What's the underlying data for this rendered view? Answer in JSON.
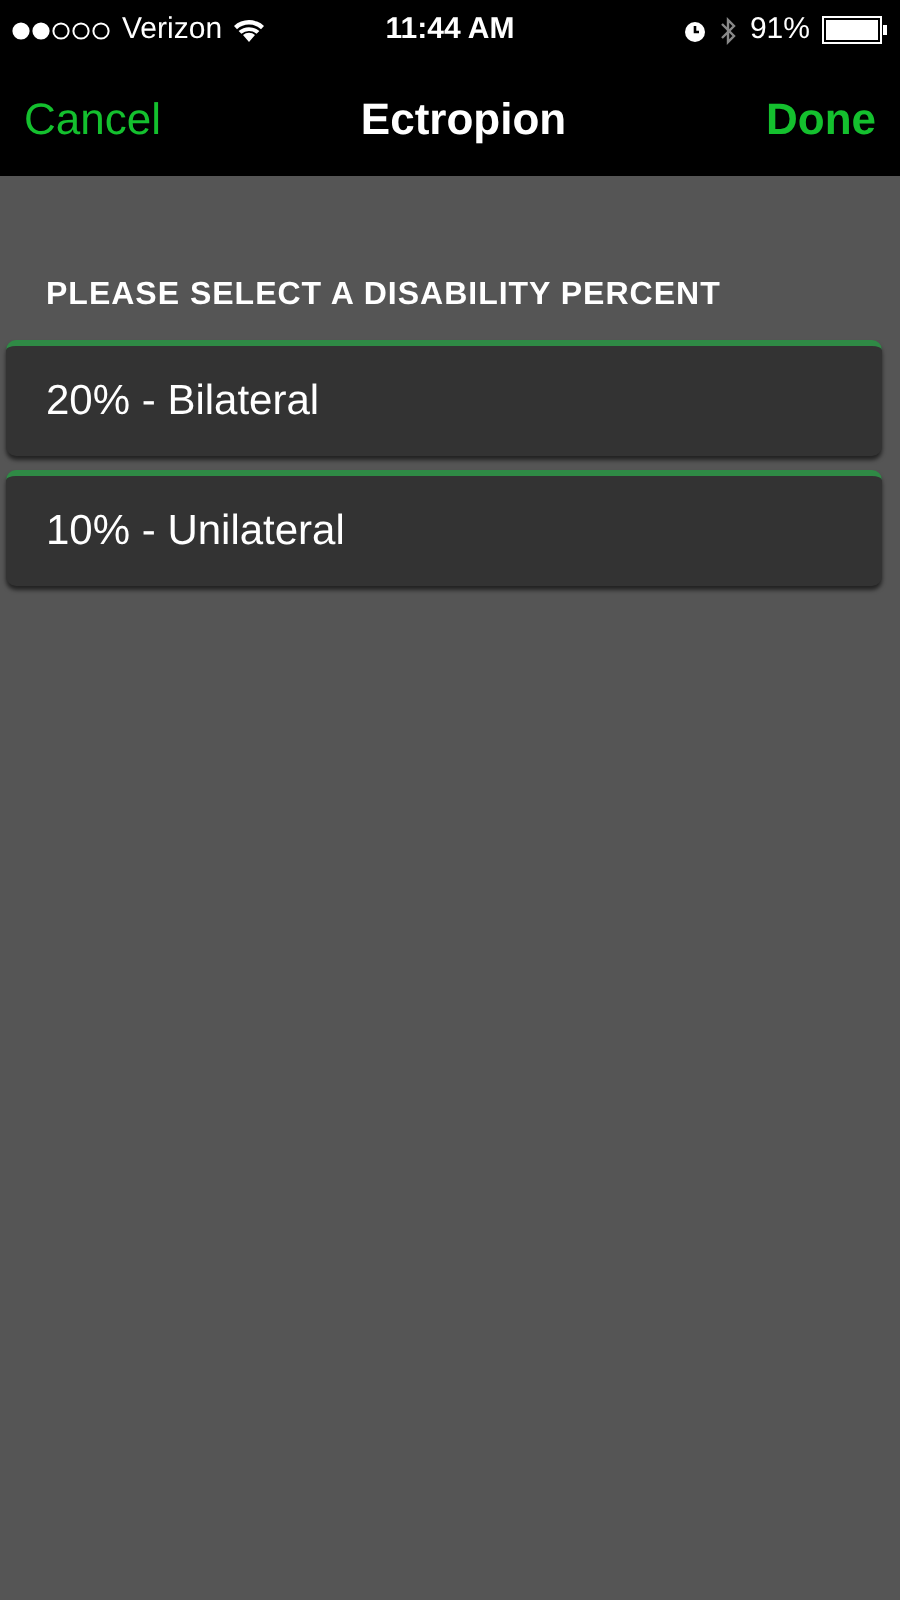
{
  "status_bar": {
    "carrier": "Verizon",
    "time": "11:44 AM",
    "battery": "91%"
  },
  "nav": {
    "cancel": "Cancel",
    "title": "Ectropion",
    "done": "Done"
  },
  "section_header": "PLEASE SELECT A DISABILITY PERCENT",
  "options": [
    {
      "label": "20% - Bilateral"
    },
    {
      "label": "10% - Unilateral"
    }
  ]
}
